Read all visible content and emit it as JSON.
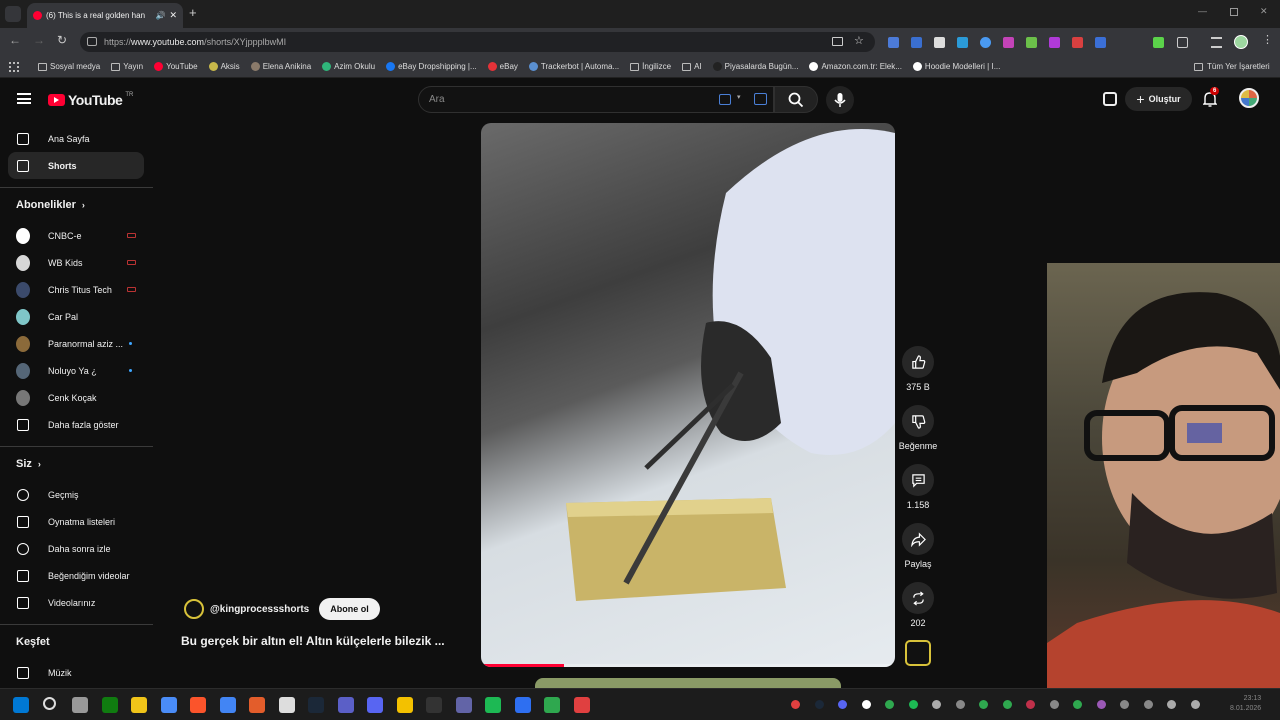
{
  "browser": {
    "tab_title": "(6) This is a real golden han",
    "url_scheme": "https://",
    "url_host": "www.youtube.com",
    "url_path": "/shorts/XYjppplbwMI",
    "bookmarks": [
      {
        "label": "Sosyal medya",
        "kind": "folder"
      },
      {
        "label": "Yayın",
        "kind": "folder"
      },
      {
        "label": "YouTube",
        "kind": "site",
        "color": "#ff0033"
      },
      {
        "label": "Aksis",
        "kind": "site",
        "color": "#c8b84a"
      },
      {
        "label": "Elena Anikina",
        "kind": "site",
        "color": "#8a7a6a"
      },
      {
        "label": "Azim Okulu",
        "kind": "site",
        "color": "#2fb57a"
      },
      {
        "label": "eBay Dropshipping |...",
        "kind": "site",
        "color": "#1877f2"
      },
      {
        "label": "eBay",
        "kind": "site",
        "color": "#e53238"
      },
      {
        "label": "Trackerbot | Automa...",
        "kind": "site",
        "color": "#5a8fd0"
      },
      {
        "label": "İngilizce",
        "kind": "folder"
      },
      {
        "label": "AI",
        "kind": "folder"
      },
      {
        "label": "Piyasalarda Bugün...",
        "kind": "site",
        "color": "#222222"
      },
      {
        "label": "Amazon.com.tr: Elek...",
        "kind": "site",
        "color": "#ffffff"
      },
      {
        "label": "Hoodie Modelleri | I...",
        "kind": "site",
        "color": "#ffffff"
      }
    ],
    "all_bookmarks": "Tüm Yer İşaretleri"
  },
  "masthead": {
    "logo_text": "YouTube",
    "logo_region": "TR",
    "search_placeholder": "Ara",
    "create_label": "Oluştur",
    "notification_count": "6"
  },
  "sidebar": {
    "main": [
      {
        "label": "Ana Sayfa",
        "icon": "home-icon"
      },
      {
        "label": "Shorts",
        "icon": "shorts-icon",
        "active": true
      }
    ],
    "subscriptions_title": "Abonelikler",
    "subscriptions": [
      {
        "label": "CNBC-e",
        "color": "#ffffff",
        "badge": "live"
      },
      {
        "label": "WB Kids",
        "color": "#d7d7d7",
        "badge": "live"
      },
      {
        "label": "Chris Titus Tech",
        "color": "#3b4a6b",
        "badge": "live"
      },
      {
        "label": "Car Pal",
        "color": "#7fc6c8",
        "badge": ""
      },
      {
        "label": "Paranormal aziz ...",
        "color": "#8b6a3a",
        "badge": "dot"
      },
      {
        "label": "Noluyo Ya ¿",
        "color": "#556677",
        "badge": "dot"
      },
      {
        "label": "Cenk Koçak",
        "color": "#777777",
        "badge": ""
      }
    ],
    "show_more": "Daha fazla göster",
    "you_title": "Siz",
    "you_items": [
      {
        "label": "Geçmiş",
        "icon": "history-icon"
      },
      {
        "label": "Oynatma listeleri",
        "icon": "playlist-icon"
      },
      {
        "label": "Daha sonra izle",
        "icon": "clock-icon"
      },
      {
        "label": "Beğendiğim videolar",
        "icon": "like-icon"
      },
      {
        "label": "Videolarınız",
        "icon": "video-icon"
      }
    ],
    "explore_title": "Keşfet",
    "explore_items": [
      {
        "label": "Müzik",
        "icon": "music-icon"
      }
    ]
  },
  "short": {
    "channel_handle": "@kingprocessshorts",
    "subscribe_label": "Abone ol",
    "title": "Bu gerçek bir altın el! Altın külçelerle bilezik ...",
    "progress": 0.2,
    "actions": {
      "likes": "375 B",
      "dislike": "Beğenme",
      "comments": "1.158",
      "share": "Paylaş",
      "remix": "202"
    }
  },
  "taskbar": {
    "apps": [
      "windows-start-icon",
      "search-icon",
      "app-icon",
      "xbox-icon",
      "explorer-icon",
      "store-icon",
      "brave-icon",
      "chrome-icon",
      "game-icon",
      "epic-icon",
      "steam-icon",
      "teams-icon",
      "discord-icon",
      "norton-icon",
      "terminal-icon",
      "app2-icon",
      "spotify-icon",
      "app3-icon",
      "app4-icon",
      "app5-icon"
    ],
    "app_colors": [
      "#0078d4",
      "#dddddd",
      "#999999",
      "#107c10",
      "#f0c419",
      "#4a8cf7",
      "#fb542b",
      "#4285f4",
      "#e35d2b",
      "#dddddd",
      "#1b2838",
      "#5b5fc7",
      "#5865f2",
      "#f3c100",
      "#333333",
      "#6264a7",
      "#1db954",
      "#2e6ff1",
      "#2fa84f",
      "#e04040"
    ],
    "clock_time": "23:13",
    "clock_date": "8.01.2026"
  }
}
